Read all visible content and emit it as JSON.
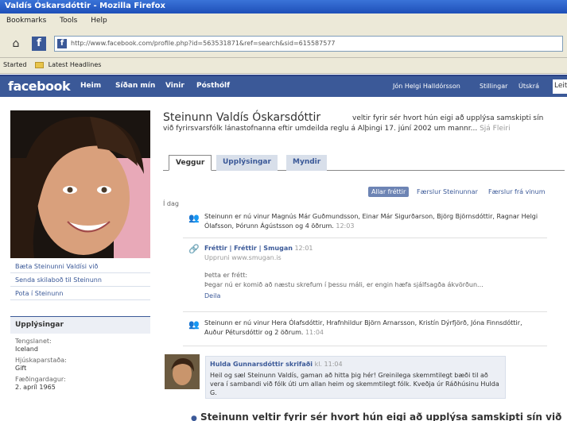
{
  "window": {
    "title": "Valdís Óskarsdóttir - Mozilla Firefox"
  },
  "menu": {
    "items": [
      "Bookmarks",
      "Tools",
      "Help"
    ]
  },
  "browser": {
    "url": "http://www.facebook.com/profile.php?id=563531871&ref=search&sid=615587577",
    "bookmarks": [
      "Started",
      "Latest Headlines"
    ]
  },
  "fb": {
    "logo": "facebook",
    "nav": [
      "Heim",
      "Síðan mín",
      "Vinir",
      "Pósthólf"
    ],
    "user": "Jón Helgi Halldórsson",
    "settings": "Stillingar",
    "logout": "Útskrá",
    "search": "Leit"
  },
  "profile": {
    "name": "Steinunn Valdís Óskarsdóttir",
    "status": "veltir fyrir sér hvort hún eigi að upplýsa samskipti sín við fyrirsvarsfólk lánastofnanna eftir umdeilda reglu á Alþingi 17. júní 2002 um mannr...",
    "status_time": "Sjá Fleiri",
    "links": [
      "Bæta Steinunni Valdísi við",
      "Senda skilaboð til Steinunn",
      "Pota í Steinunn"
    ],
    "info_title": "Upplýsingar",
    "info": [
      {
        "label": "Tengslanet:",
        "value": "Iceland"
      },
      {
        "label": "Hjúskaparstaða:",
        "value": "Gift"
      },
      {
        "label": "Fæðingardagur:",
        "value": "2. apríl 1965"
      }
    ]
  },
  "tabs": [
    "Veggur",
    "Upplýsingar",
    "Myndir"
  ],
  "filters": {
    "active": "Allar fréttir",
    "others": [
      "Færslur Steinunnar",
      "Færslur frá vinum"
    ]
  },
  "feed": {
    "day": "Í dag",
    "story1": "Steinunn er nú vinur Magnús Már Guðmundsson, Einar Már Sigurðarson, Björg Björnsdóttir, Ragnar Helgi Ólafsson, Þórunn Ágústsson og 4 öðrum.",
    "story1_time": "12:03",
    "story2_title": "Fréttir | Fréttir | Smugan",
    "story2_time": "12:01",
    "story2_source": "Uppruni www.smugan.is",
    "story2_subtitle": "Þetta er frétt:",
    "story2_quote": "Þegar nú er komið að næstu skrefum í þessu máli, er engin hæfa sjálfsagða ákvörðun...",
    "story2_action": "Deila",
    "story3": "Steinunn er nú vinur Hera Ólafsdóttir, Hrafnhildur Björn Arnarsson, Kristín Dýrfjörð, Jóna Finnsdóttir, Auður Pétursdóttir og 2 öðrum.",
    "story3_time": "11:04",
    "post_author": "Hulda Gunnarsdóttir skrifaði",
    "post_time": "kl. 11:04",
    "post_text": "Heil og sæl Steinunn Valdís, gaman að hitta þig hér! Greinilega skemmtilegt bæði til að vera í sambandi við fólk úti um allan heim og skemmtilegt fólk. Kveðja úr Ráðhúsinu Hulda G.",
    "bottom": "Steinunn veltir fyrir sér hvort hún eigi að upplýsa samskipti sín við"
  }
}
